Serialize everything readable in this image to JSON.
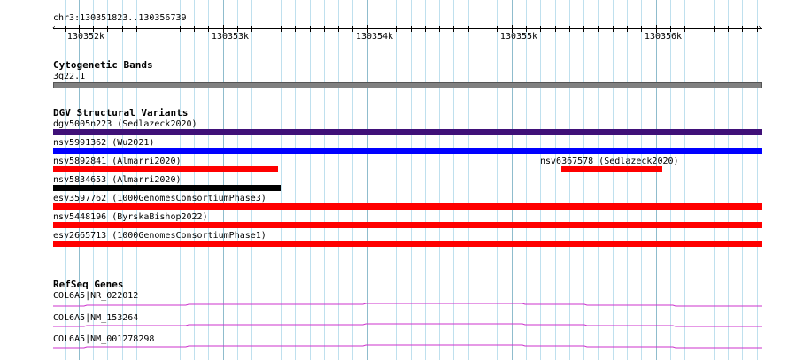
{
  "ruler": {
    "location": "chr3:130351823..130356739",
    "start": 130351823,
    "end": 130356739,
    "tick_labels": [
      "130352k",
      "130353k",
      "130354k",
      "130355k",
      "130356k"
    ],
    "tick_positions_bp": [
      130352000,
      130353000,
      130354000,
      130355000,
      130356000
    ]
  },
  "cytobands": {
    "title": "Cytogenetic Bands",
    "band_label": "3q22.1",
    "color": "#808080"
  },
  "dgv": {
    "title": "DGV Structural Variants",
    "variants": [
      {
        "label": "dgv5005n223 (Sedlazeck2020)",
        "start": 130351823,
        "end": 130356739,
        "color": "#3f1078"
      },
      {
        "label": "nsv5991362 (Wu2021)",
        "start": 130351823,
        "end": 130356739,
        "color": "#0000ff"
      },
      {
        "label": "nsv5892841 (Almarri2020)",
        "start": 130351823,
        "end": 130353380,
        "color": "#ff0000"
      },
      {
        "label": "nsv6367578 (Sedlazeck2020)",
        "start": 130355345,
        "end": 130356043,
        "color": "#ff0000"
      },
      {
        "label": "nsv5834653 (Almarri2020)",
        "start": 130351823,
        "end": 130353400,
        "color": "#000000"
      },
      {
        "label": "esv3597762 (1000GenomesConsortiumPhase3)",
        "start": 130351823,
        "end": 130356739,
        "color": "#ff0000"
      },
      {
        "label": "nsv5448196 (ByrskaBishop2022)",
        "start": 130351823,
        "end": 130356739,
        "color": "#ff0000"
      },
      {
        "label": "esv2665713 (1000GenomesConsortiumPhase1)",
        "start": 130351823,
        "end": 130356739,
        "color": "#ff0000"
      }
    ]
  },
  "refseq": {
    "title": "RefSeq Genes",
    "color": "#cc33cc",
    "genes": [
      {
        "label": "COL6A5|NR_022012"
      },
      {
        "label": "COL6A5|NM_153264"
      },
      {
        "label": "COL6A5|NM_001278298"
      }
    ]
  }
}
